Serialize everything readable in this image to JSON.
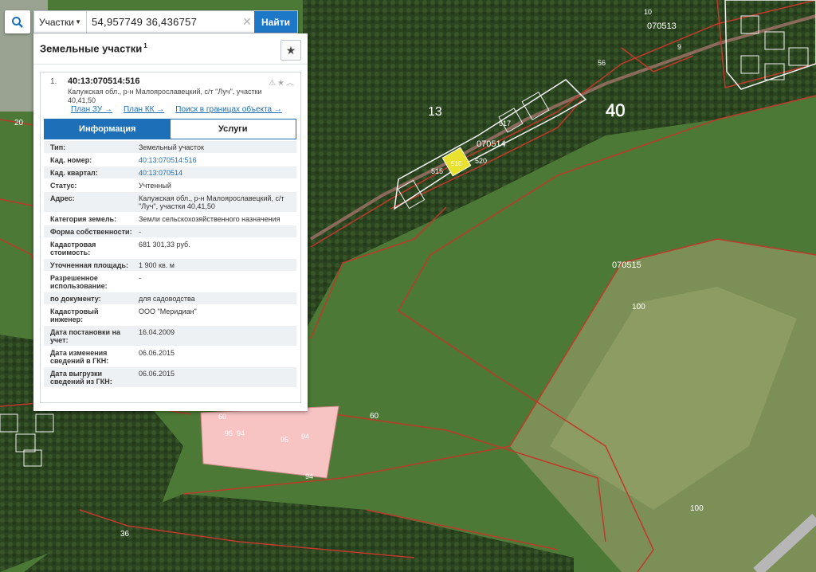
{
  "search": {
    "layer_label": "Участки",
    "query": "54,957749 36,436757",
    "find_label": "Найти"
  },
  "panel": {
    "title": "Земельные участки",
    "title_count": "1",
    "result": {
      "index": "1.",
      "number": "40:13:070514:516",
      "address": "Калужская обл., р-н Малоярославецкий, с/т \"Луч\", участки 40,41,50",
      "links": [
        "План ЗУ →",
        "План КК →",
        "Поиск в границах объекта →"
      ],
      "tabs": [
        "Информация",
        "Услуги"
      ],
      "rows": [
        {
          "key": "Тип:",
          "value": "Земельный участок"
        },
        {
          "key": "Кад. номер:",
          "value": "40:13:070514:516"
        },
        {
          "key": "Кад. квартал:",
          "value": "40:13:070514"
        },
        {
          "key": "Статус:",
          "value": "Учтенный"
        },
        {
          "key": "Адрес:",
          "value": "Калужская обл., р-н Малоярославецкий, с/т \"Луч\", участки 40,41,50"
        },
        {
          "key": "Категория земель:",
          "value": "Земли сельскохозяйственного назначения"
        },
        {
          "key": "Форма собственности:",
          "value": "-"
        },
        {
          "key": "Кадастровая стоимость:",
          "value": "681 301,33 руб."
        },
        {
          "key": "Уточненная площадь:",
          "value": "1 900 кв. м"
        },
        {
          "key": "Разрешенное использование:",
          "value": "-"
        },
        {
          "key": "по документу:",
          "value": "для садоводства"
        },
        {
          "key": "Кадастровый инженер:",
          "value": "ООО \"Меридиан\""
        },
        {
          "key": "Дата постановки на учет:",
          "value": "16.04.2009"
        },
        {
          "key": "Дата изменения сведений в ГКН:",
          "value": "06.06.2015"
        },
        {
          "key": "Дата выгрузки сведений из ГКН:",
          "value": "06.06.2015"
        }
      ]
    }
  },
  "map": {
    "labels": {
      "district": "13",
      "region": "40",
      "block_070514": "070514",
      "block_070513": "070513",
      "block_070515": "070515",
      "parcel_100a": "100",
      "parcel_100b": "100",
      "parcel_60a": "60",
      "parcel_60b": "60",
      "parcel_36": "36",
      "parcel_94a": "94",
      "parcel_94b": "94",
      "parcel_95a": "95",
      "parcel_95b": "95",
      "parcel_94c": "94",
      "parcel_20": "20",
      "parcel_517": "517",
      "parcel_516": "516",
      "parcel_520": "520",
      "parcel_515": "515",
      "parcel_56": "56",
      "parcel_10": "10",
      "parcel_9": "9"
    },
    "colors": {
      "forest": "#2f4a22",
      "field": "#4f7a35",
      "boundary": "#c0392b",
      "highlight": "#e8e22e",
      "pink_parcel": "#f7c3c3"
    }
  }
}
